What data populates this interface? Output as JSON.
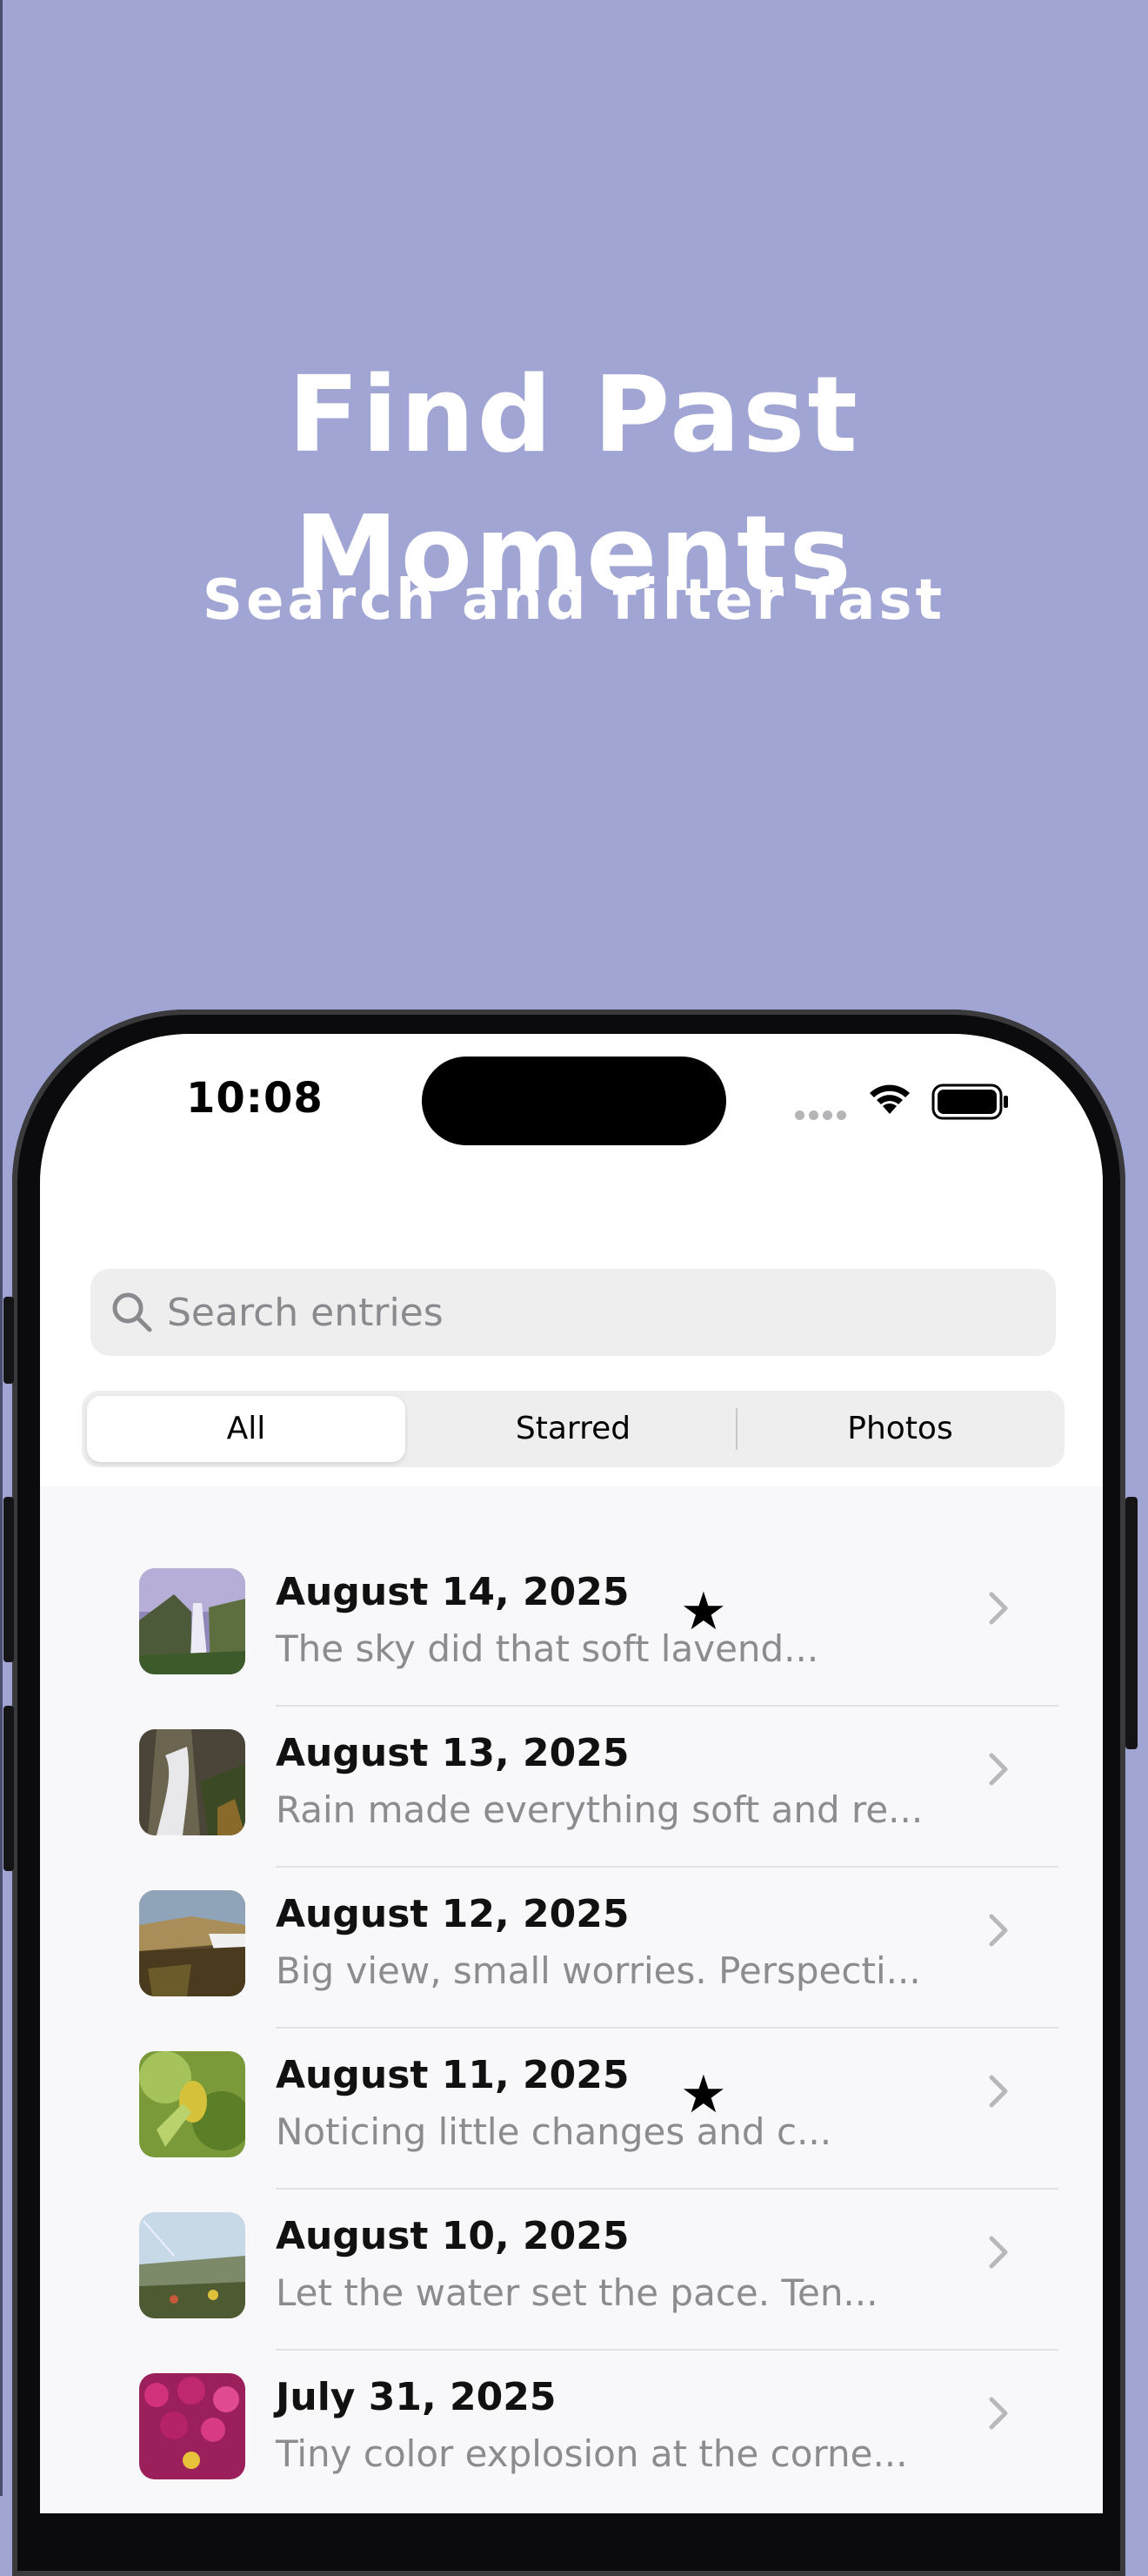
{
  "promo": {
    "headline": "Find Past Moments",
    "subheadline": "Search and filter fast"
  },
  "status_bar": {
    "time": "10:08"
  },
  "search": {
    "placeholder": "Search entries",
    "value": ""
  },
  "filter_tabs": [
    {
      "label": "All",
      "selected": true
    },
    {
      "label": "Starred",
      "selected": false
    },
    {
      "label": "Photos",
      "selected": false
    }
  ],
  "entries": [
    {
      "date": "August 14, 2025",
      "excerpt": "The sky did that soft lavend...",
      "starred": true,
      "icon": "star-icon"
    },
    {
      "date": "August 13, 2025",
      "excerpt": "Rain made everything soft and re...",
      "starred": false
    },
    {
      "date": "August 12, 2025",
      "excerpt": "Big view, small worries. Perspecti...",
      "starred": false
    },
    {
      "date": "August 11, 2025",
      "excerpt": "Noticing little changes and c...",
      "starred": true,
      "icon": "star-icon"
    },
    {
      "date": "August 10, 2025",
      "excerpt": "Let the water set the pace. Ten...",
      "starred": false
    },
    {
      "date": "July 31, 2025",
      "excerpt": "Tiny color explosion at the corne...",
      "starred": false
    }
  ],
  "colors": {
    "background": "#a0a5d3",
    "screen": "#f8f8fa"
  }
}
